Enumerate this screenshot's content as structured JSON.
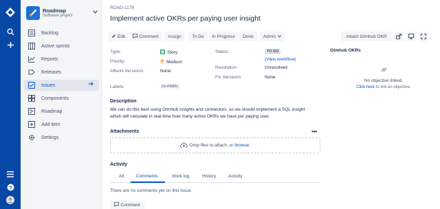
{
  "sidebar": {
    "project_name": "Roadmap",
    "project_type": "Software project",
    "items": [
      {
        "label": "Backlog",
        "icon": "backlog-icon"
      },
      {
        "label": "Active sprints",
        "icon": "board-icon"
      },
      {
        "label": "Reports",
        "icon": "reports-icon"
      },
      {
        "label": "Releases",
        "icon": "releases-icon"
      },
      {
        "label": "Issues",
        "icon": "issues-icon",
        "active": true
      },
      {
        "label": "Components",
        "icon": "components-icon"
      },
      {
        "label": "Roadmap",
        "icon": "roadmap-icon"
      },
      {
        "label": "Add item",
        "icon": "add-item-icon"
      },
      {
        "label": "Settings",
        "icon": "settings-icon"
      }
    ]
  },
  "issue": {
    "key": "ROAD-1179",
    "title": "Implement active OKRs per paying user insight"
  },
  "toolbar": {
    "edit": "Edit",
    "comment": "Comment",
    "assign": "Assign",
    "to_do": "To Do",
    "in_progress": "In Progress",
    "done": "Done",
    "admin": "Admin",
    "attach_okr": "Attach Gtmhub OKR"
  },
  "details": {
    "type_label": "Type:",
    "type_value": "Story",
    "priority_label": "Priority:",
    "priority_value": "Medium",
    "affects_label": "Affects Version/s:",
    "affects_value": "None",
    "labels_label": "Labels:",
    "labels_value": "cs-metric",
    "status_label": "Status:",
    "status_value": "TO DO",
    "view_workflow": "(View workflow)",
    "resolution_label": "Resolution:",
    "resolution_value": "Unresolved",
    "fix_label": "Fix Version/s:",
    "fix_value": "None"
  },
  "okr_panel": {
    "title": "Gtmhub OKRs",
    "empty": "No objective linked.",
    "click_here": "Click here",
    "link_text": "to link an objective."
  },
  "description": {
    "heading": "Description",
    "text": "We can do this best using Gtmhub insights and connectors, so we should implement a SQL insight which will calculate in real-time how many active OKRs we have per paying user."
  },
  "attachments": {
    "heading": "Attachments",
    "drop_text": "Drop files to attach, or",
    "browse": "browse."
  },
  "activity": {
    "heading": "Activity",
    "tabs": [
      "All",
      "Comments",
      "Work log",
      "History",
      "Activity"
    ],
    "empty": "There are no comments yet on this issue.",
    "comment_button": "Comment"
  },
  "colors": {
    "global_nav": "#0747a6",
    "link": "#0052cc",
    "story": "#36b37e",
    "priority_medium": "#ff991f"
  }
}
